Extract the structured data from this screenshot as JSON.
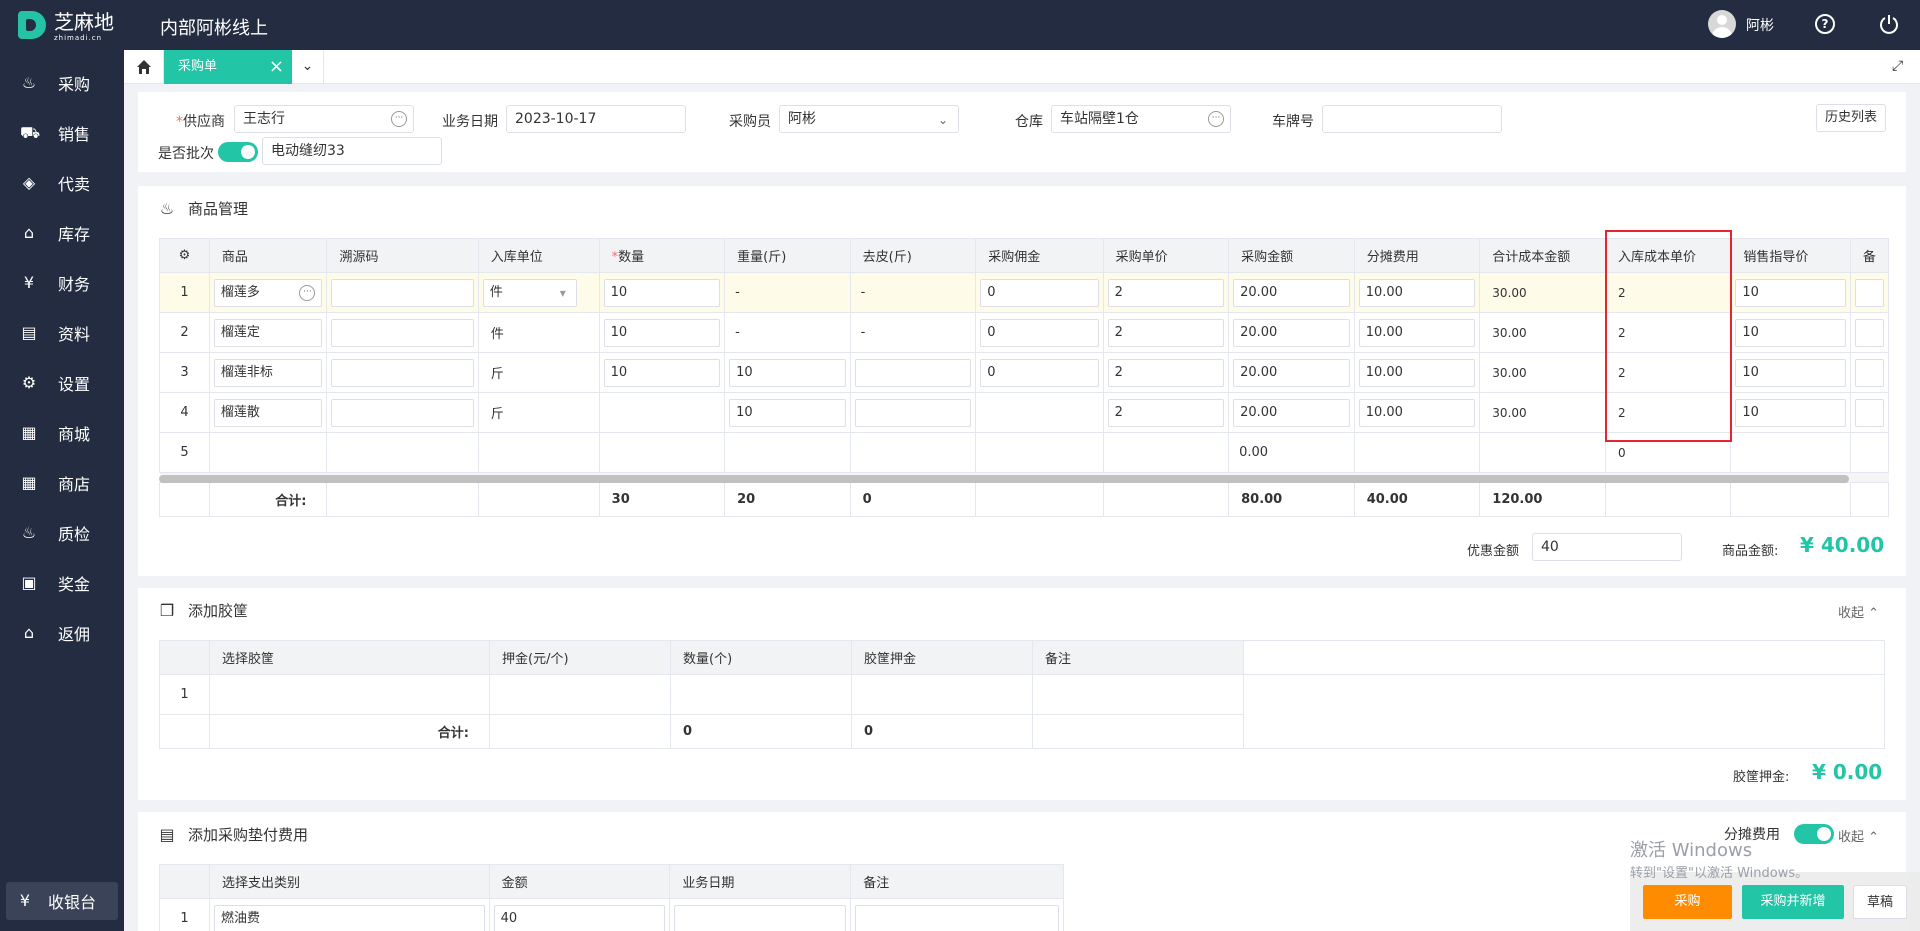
{
  "header": {
    "logo_cn": "芝麻地",
    "logo_en": "zhimadi.cn",
    "app_title": "内部阿彬线上",
    "user": "阿彬"
  },
  "sidebar": {
    "items": [
      "采购",
      "销售",
      "代卖",
      "库存",
      "财务",
      "资料",
      "设置",
      "商城",
      "商店",
      "质检",
      "奖金",
      "返佣"
    ],
    "footer": "收银台"
  },
  "tabs": {
    "active": "采购单",
    "close": "×",
    "more": "⌄"
  },
  "form": {
    "supplier_label": "供应商",
    "supplier_value": "王志行",
    "date_label": "业务日期",
    "date_value": "2023-10-17",
    "buyer_label": "采购员",
    "buyer_value": "阿彬",
    "warehouse_label": "仓库",
    "warehouse_value": "车站隔壁1仓",
    "plate_label": "车牌号",
    "plate_value": "",
    "batch_label": "是否批次",
    "batch_value": "电动缝纫33",
    "history_button": "历史列表"
  },
  "goods": {
    "title": "商品管理",
    "columns": [
      "商品",
      "溯源码",
      "入库单位",
      "数量",
      "重量(斤)",
      "去皮(斤)",
      "采购佣金",
      "采购单价",
      "采购金额",
      "分摊费用",
      "合计成本金额",
      "入库成本单价",
      "销售指导价",
      "备"
    ],
    "rows": [
      {
        "no": "1",
        "product": "榴莲多",
        "unit": "件",
        "qty": "10",
        "weight": "-",
        "tare": "-",
        "commission": "0",
        "price": "2",
        "amount": "20.00",
        "share": "10.00",
        "total": "30.00",
        "unit_cost": "2",
        "guide": "10"
      },
      {
        "no": "2",
        "product": "榴莲定",
        "unit": "件",
        "qty": "10",
        "weight": "-",
        "tare": "-",
        "commission": "0",
        "price": "2",
        "amount": "20.00",
        "share": "10.00",
        "total": "30.00",
        "unit_cost": "2",
        "guide": "10"
      },
      {
        "no": "3",
        "product": "榴莲非标",
        "unit": "斤",
        "qty": "10",
        "weight": "10",
        "tare": "",
        "commission": "0",
        "price": "2",
        "amount": "20.00",
        "share": "10.00",
        "total": "30.00",
        "unit_cost": "2",
        "guide": "10"
      },
      {
        "no": "4",
        "product": "榴莲散",
        "unit": "斤",
        "qty": "",
        "weight": "10",
        "tare": "",
        "commission": "",
        "price": "2",
        "amount": "20.00",
        "share": "10.00",
        "total": "30.00",
        "unit_cost": "2",
        "guide": "10"
      },
      {
        "no": "5",
        "product": "",
        "unit": "",
        "qty": "",
        "weight": "",
        "tare": "",
        "commission": "",
        "price": "",
        "amount": "0.00",
        "share": "",
        "total": "",
        "unit_cost": "0",
        "guide": ""
      }
    ],
    "sum_label": "合计:",
    "sum_qty": "30",
    "sum_weight": "20",
    "sum_tare": "0",
    "sum_amount": "80.00",
    "sum_share": "40.00",
    "sum_total": "120.00",
    "discount_label": "优惠金额",
    "discount_value": "40",
    "goods_amount_label": "商品金额:",
    "goods_amount": "¥ 40.00"
  },
  "baskets": {
    "title": "添加胶筐",
    "collapse": "收起 ⌃",
    "columns": [
      "选择胶筐",
      "押金(元/个)",
      "数量(个)",
      "胶筐押金",
      "备注"
    ],
    "row_no": "1",
    "sum_label": "合计:",
    "sum_qty": "0",
    "sum_deposit": "0",
    "deposit_label": "胶筐押金:",
    "deposit_value": "¥ 0.00"
  },
  "fees": {
    "title": "添加采购垫付费用",
    "share_label": "分摊费用",
    "collapse": "收起 ⌃",
    "columns": [
      "选择支出类别",
      "金额",
      "业务日期",
      "备注"
    ],
    "row_no": "1",
    "category": "燃油费",
    "amount": "40"
  },
  "watermark": {
    "line1": "激活 Windows",
    "line2": "转到\"设置\"以激活 Windows。"
  },
  "actions": {
    "purchase": "采购",
    "purchase_new": "采购并新增",
    "draft": "草稿"
  },
  "colors": {
    "accent": "#23c5a7",
    "sidebar": "#232c40",
    "orange": "#ff8c00",
    "highlight_box": "#e5262f"
  }
}
